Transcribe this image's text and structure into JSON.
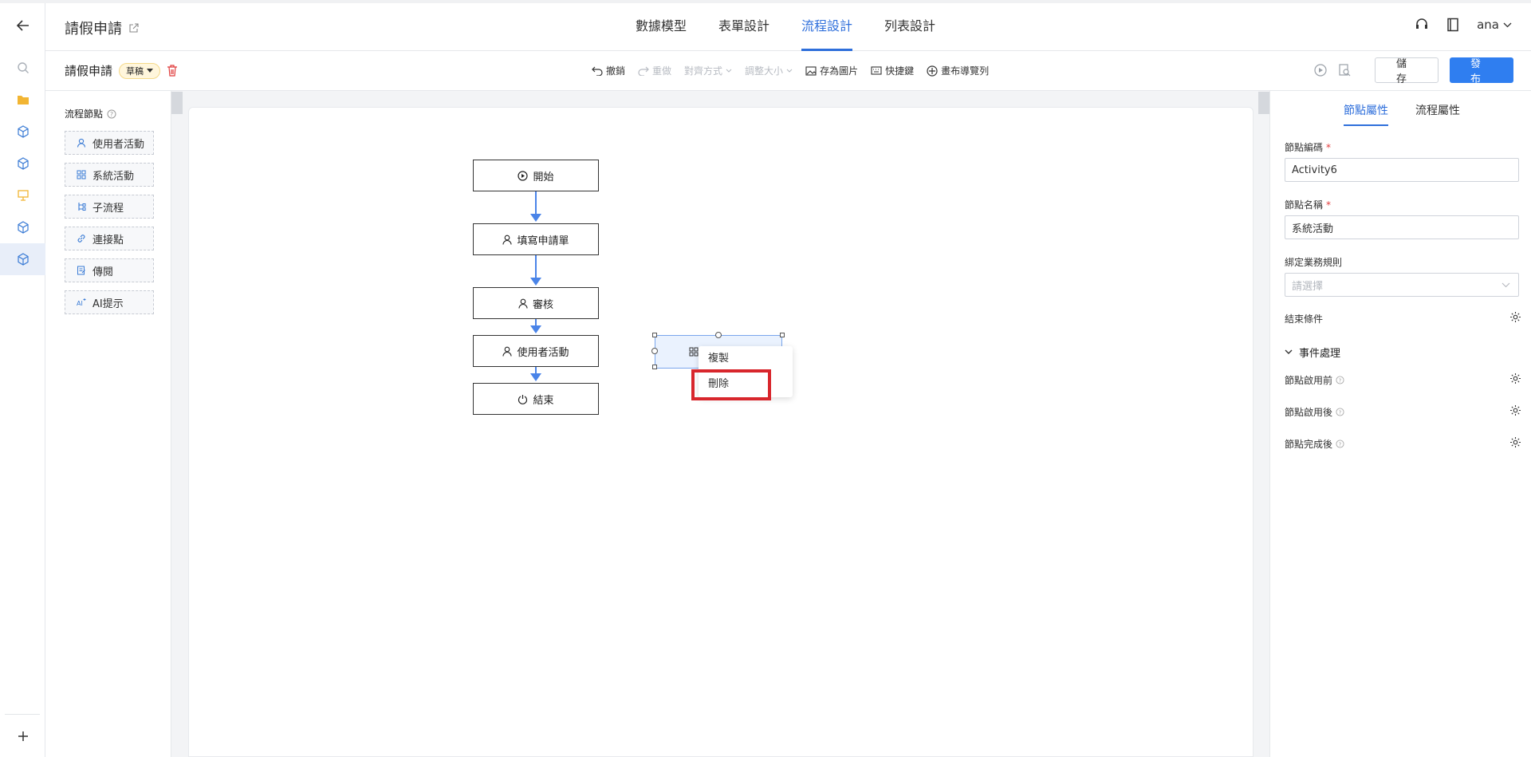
{
  "header": {
    "app_title": "請假申請",
    "tabs": [
      "數據模型",
      "表單設計",
      "流程設計",
      "列表設計"
    ],
    "active_tab": "流程設計",
    "user": "ana"
  },
  "toolbar": {
    "process_name": "請假申請",
    "status_badge": "草稿",
    "undo": "撤銷",
    "redo": "重做",
    "align": "對齊方式",
    "resize": "調整大小",
    "save_image": "存為圖片",
    "shortcuts": "快捷鍵",
    "canvas_nav": "畫布導覽列",
    "save_label": "儲 存",
    "publish_label": "發 布"
  },
  "node_panel": {
    "title": "流程節點",
    "items": [
      {
        "label": "使用者活動",
        "icon": "user-icon"
      },
      {
        "label": "系統活動",
        "icon": "grid-icon"
      },
      {
        "label": "子流程",
        "icon": "subprocess-icon"
      },
      {
        "label": "連接點",
        "icon": "link-icon"
      },
      {
        "label": "傳閱",
        "icon": "doc-icon"
      },
      {
        "label": "AI提示",
        "icon": "ai-icon"
      }
    ]
  },
  "flow": {
    "nodes": [
      "開始",
      "填寫申請單",
      "審核",
      "使用者活動",
      "結束"
    ]
  },
  "context_menu": {
    "copy": "複製",
    "delete": "刪除"
  },
  "right_panel": {
    "tabs": [
      "節點屬性",
      "流程屬性"
    ],
    "node_code_label": "節點編碼",
    "node_code_value": "Activity6",
    "node_name_label": "節點名稱",
    "node_name_value": "系統活動",
    "rule_label": "綁定業務規則",
    "rule_placeholder": "請選擇",
    "end_condition": "結束條件",
    "event_section": "事件處理",
    "before_enable": "節點啟用前",
    "after_enable": "節點啟用後",
    "after_complete": "節點完成後"
  },
  "colors": {
    "accent": "#2f6fdb",
    "publish": "#2f7ef0",
    "highlight": "#d8262c",
    "connector": "#4a84e8"
  }
}
